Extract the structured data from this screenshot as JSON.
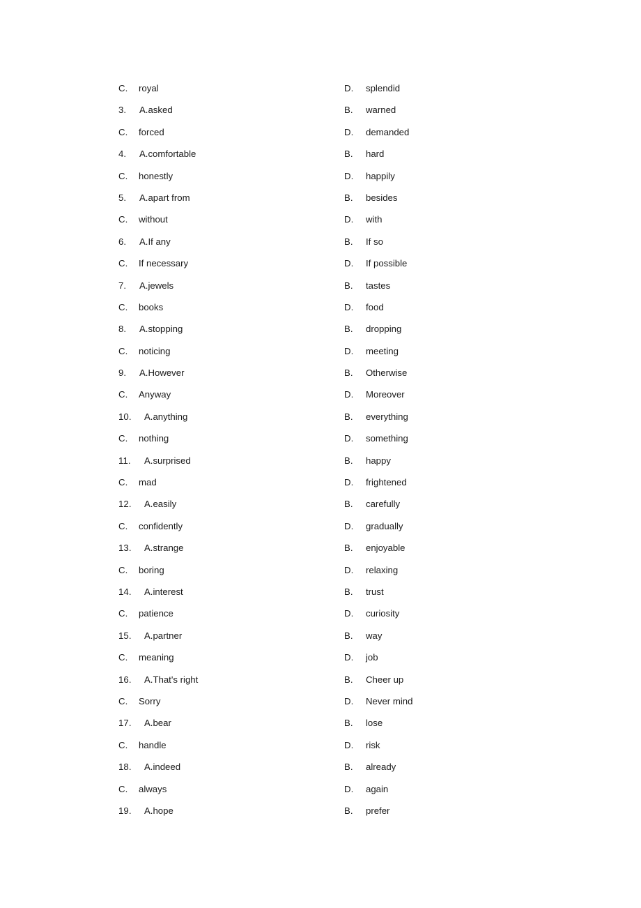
{
  "document": {
    "type": "multiple-choice-options-list",
    "background_color": "#ffffff",
    "text_color": "#1a1a1a",
    "columns": 2
  },
  "rows": [
    {
      "left": {
        "label": "C.",
        "text": "royal",
        "kind": "letter"
      },
      "right": {
        "label": "D.",
        "text": "splendid",
        "kind": "letter"
      }
    },
    {
      "left": {
        "label": "3.",
        "text": "A.asked",
        "kind": "number"
      },
      "right": {
        "label": "B.",
        "text": "warned",
        "kind": "letter"
      }
    },
    {
      "left": {
        "label": "C.",
        "text": "forced",
        "kind": "letter"
      },
      "right": {
        "label": "D.",
        "text": "demanded",
        "kind": "letter"
      }
    },
    {
      "left": {
        "label": "4.",
        "text": "A.comfortable",
        "kind": "number"
      },
      "right": {
        "label": "B.",
        "text": "hard",
        "kind": "letter"
      }
    },
    {
      "left": {
        "label": "C.",
        "text": "honestly",
        "kind": "letter"
      },
      "right": {
        "label": "D.",
        "text": "happily",
        "kind": "letter"
      }
    },
    {
      "left": {
        "label": "5.",
        "text": "A.apart from",
        "kind": "number"
      },
      "right": {
        "label": "B.",
        "text": "besides",
        "kind": "letter"
      }
    },
    {
      "left": {
        "label": "C.",
        "text": "without",
        "kind": "letter"
      },
      "right": {
        "label": "D.",
        "text": "with",
        "kind": "letter"
      }
    },
    {
      "left": {
        "label": "6.",
        "text": "A.If any",
        "kind": "number"
      },
      "right": {
        "label": "B.",
        "text": "If so",
        "kind": "letter"
      }
    },
    {
      "left": {
        "label": "C.",
        "text": "If necessary",
        "kind": "letter"
      },
      "right": {
        "label": "D.",
        "text": "If possible",
        "kind": "letter"
      }
    },
    {
      "left": {
        "label": "7.",
        "text": "A.jewels",
        "kind": "number"
      },
      "right": {
        "label": "B.",
        "text": "tastes",
        "kind": "letter"
      }
    },
    {
      "left": {
        "label": "C.",
        "text": "books",
        "kind": "letter"
      },
      "right": {
        "label": "D.",
        "text": "food",
        "kind": "letter"
      }
    },
    {
      "left": {
        "label": "8.",
        "text": "A.stopping",
        "kind": "number"
      },
      "right": {
        "label": "B.",
        "text": "dropping",
        "kind": "letter"
      }
    },
    {
      "left": {
        "label": "C.",
        "text": "noticing",
        "kind": "letter"
      },
      "right": {
        "label": "D.",
        "text": "meeting",
        "kind": "letter"
      }
    },
    {
      "left": {
        "label": "9.",
        "text": "A.However",
        "kind": "number"
      },
      "right": {
        "label": "B.",
        "text": "Otherwise",
        "kind": "letter"
      }
    },
    {
      "left": {
        "label": "C.",
        "text": "Anyway",
        "kind": "letter"
      },
      "right": {
        "label": "D.",
        "text": "Moreover",
        "kind": "letter"
      }
    },
    {
      "left": {
        "label": "10.",
        "text": "A.anything",
        "kind": "number-wide"
      },
      "right": {
        "label": "B.",
        "text": "everything",
        "kind": "letter"
      }
    },
    {
      "left": {
        "label": "C.",
        "text": "nothing",
        "kind": "letter"
      },
      "right": {
        "label": "D.",
        "text": "something",
        "kind": "letter"
      }
    },
    {
      "left": {
        "label": "11.",
        "text": "A.surprised",
        "kind": "number-wide"
      },
      "right": {
        "label": "B.",
        "text": "happy",
        "kind": "letter"
      }
    },
    {
      "left": {
        "label": "C.",
        "text": "mad",
        "kind": "letter"
      },
      "right": {
        "label": "D.",
        "text": "frightened",
        "kind": "letter"
      }
    },
    {
      "left": {
        "label": "12.",
        "text": "A.easily",
        "kind": "number-wide"
      },
      "right": {
        "label": "B.",
        "text": "carefully",
        "kind": "letter"
      }
    },
    {
      "left": {
        "label": "C.",
        "text": "confidently",
        "kind": "letter"
      },
      "right": {
        "label": "D.",
        "text": "gradually",
        "kind": "letter"
      }
    },
    {
      "left": {
        "label": "13.",
        "text": "A.strange",
        "kind": "number-wide"
      },
      "right": {
        "label": "B.",
        "text": "enjoyable",
        "kind": "letter"
      }
    },
    {
      "left": {
        "label": "C.",
        "text": "boring",
        "kind": "letter"
      },
      "right": {
        "label": "D.",
        "text": "relaxing",
        "kind": "letter"
      }
    },
    {
      "left": {
        "label": "14.",
        "text": "A.interest",
        "kind": "number-wide"
      },
      "right": {
        "label": "B.",
        "text": "trust",
        "kind": "letter"
      }
    },
    {
      "left": {
        "label": "C.",
        "text": "patience",
        "kind": "letter"
      },
      "right": {
        "label": "D.",
        "text": "curiosity",
        "kind": "letter"
      }
    },
    {
      "left": {
        "label": "15.",
        "text": "A.partner",
        "kind": "number-wide"
      },
      "right": {
        "label": "B.",
        "text": "way",
        "kind": "letter"
      }
    },
    {
      "left": {
        "label": "C.",
        "text": "meaning",
        "kind": "letter"
      },
      "right": {
        "label": "D.",
        "text": "job",
        "kind": "letter"
      }
    },
    {
      "left": {
        "label": "16.",
        "text": "A.That's right",
        "kind": "number-wide"
      },
      "right": {
        "label": "B.",
        "text": "Cheer up",
        "kind": "letter"
      }
    },
    {
      "left": {
        "label": "C.",
        "text": "Sorry",
        "kind": "letter"
      },
      "right": {
        "label": "D.",
        "text": "Never mind",
        "kind": "letter"
      }
    },
    {
      "left": {
        "label": "17.",
        "text": "A.bear",
        "kind": "number-wide"
      },
      "right": {
        "label": "B.",
        "text": "lose",
        "kind": "letter"
      }
    },
    {
      "left": {
        "label": "C.",
        "text": "handle",
        "kind": "letter"
      },
      "right": {
        "label": "D.",
        "text": "risk",
        "kind": "letter"
      }
    },
    {
      "left": {
        "label": "18.",
        "text": "A.indeed",
        "kind": "number-wide"
      },
      "right": {
        "label": "B.",
        "text": "already",
        "kind": "letter"
      }
    },
    {
      "left": {
        "label": "C.",
        "text": "always",
        "kind": "letter"
      },
      "right": {
        "label": "D.",
        "text": "again",
        "kind": "letter"
      }
    },
    {
      "left": {
        "label": "19.",
        "text": "A.hope",
        "kind": "number-wide"
      },
      "right": {
        "label": "B.",
        "text": "prefer",
        "kind": "letter"
      }
    }
  ]
}
